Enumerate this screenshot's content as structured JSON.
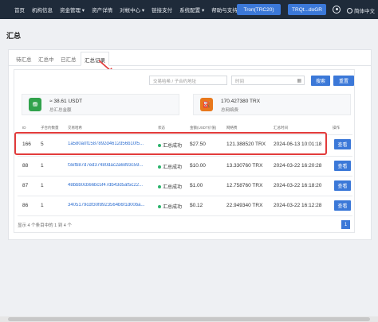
{
  "nav": {
    "items": [
      "首页",
      "机构信息",
      "资金管理 ▾",
      "资产详情",
      "对帐中心 ▾",
      "链接支付",
      "系统配置 ▾",
      "帮助与支持"
    ],
    "network_button": "Tron(TRC20)",
    "wallet_button": "TRQt...doGR",
    "language": "简体中文"
  },
  "page": {
    "title": "汇总"
  },
  "tabs": [
    "待汇总",
    "汇总中",
    "已汇总",
    "汇总记录"
  ],
  "filters": {
    "search_placeholder": "交易哈希 / 子合约地址",
    "time_placeholder": "时间",
    "search_button": "搜索",
    "reset_button": "重置"
  },
  "stats": [
    {
      "value": "≈ 38.61 USDT",
      "label": "总汇总金额",
      "icon": "usdt-icon",
      "color": "#31a24c"
    },
    {
      "value": "170.427380 TRX",
      "label": "总网络费",
      "icon": "trx-icon",
      "color": "#e8781c"
    }
  ],
  "table": {
    "headers": [
      "ID",
      "子合约数量",
      "交易哈希",
      "状态",
      "金额(USDT价值)",
      "网络费",
      "汇总时间",
      "操作"
    ],
    "rows": [
      {
        "id": "166",
        "count": "5",
        "hash": "1a580a0f1587892d4612d56b10f5...",
        "status": "汇总成功",
        "amount": "$27.50",
        "fee": "121.388520 TRX",
        "time": "2024-06-13 10:01:18",
        "action": "查看"
      },
      {
        "id": "88",
        "count": "1",
        "hash": "f3efb87d7ed37480dac2a6893c59...",
        "status": "汇总成功",
        "amount": "$10.00",
        "fee": "13.330760 TRX",
        "time": "2024-03-22 16:20:28",
        "action": "查看"
      },
      {
        "id": "87",
        "count": "1",
        "hash": "48bbb0cb66bc5f47db43d5af5c22...",
        "status": "汇总成功",
        "amount": "$1.00",
        "fee": "12.758760 TRX",
        "time": "2024-03-22 16:18:20",
        "action": "查看"
      },
      {
        "id": "86",
        "count": "1",
        "hash": "3405179cdf30f8923564b6f1d00ba...",
        "status": "汇总成功",
        "amount": "$0.12",
        "fee": "22.949340 TRX",
        "time": "2024-03-22 16:12:28",
        "action": "查看"
      }
    ]
  },
  "pagination": {
    "summary": "显示 4 个条目中的 1 到 4 个",
    "current_page": "1"
  }
}
